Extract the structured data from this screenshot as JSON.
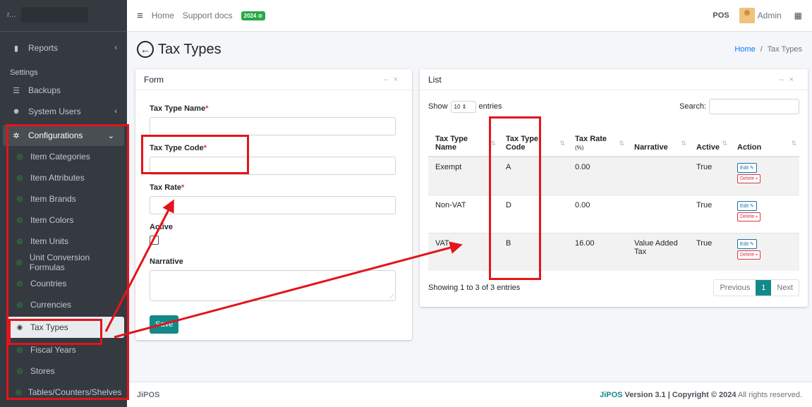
{
  "brand": {
    "text": "r..."
  },
  "sidebar": {
    "reports": "Reports",
    "settings_header": "Settings",
    "backups": "Backups",
    "system_users": "System Users",
    "configurations": "Configurations",
    "items": [
      "Item Categories",
      "Item Attributes",
      "Item Brands",
      "Item Colors",
      "Item Units",
      "Unit Conversion Formulas",
      "Countries",
      "Currencies",
      "Tax Types",
      "Fiscal Years",
      "Stores",
      "Tables/Counters/Shelves"
    ],
    "active_item": "Tax Types"
  },
  "topbar": {
    "home": "Home",
    "support": "Support docs",
    "year_badge": "2024 ⊘",
    "pos": "POS",
    "admin": "Admin"
  },
  "header": {
    "title": "Tax Types",
    "breadcrumb_home": "Home",
    "breadcrumb_sep": "/",
    "breadcrumb_current": "Tax Types"
  },
  "form": {
    "title": "Form",
    "tax_type_name": "Tax Type Name",
    "tax_type_code": "Tax Type Code",
    "tax_rate": "Tax Rate",
    "active": "Active",
    "narrative": "Narrative",
    "required_mark": "*",
    "save": "Save"
  },
  "list": {
    "title": "List",
    "show": "Show",
    "entries_value": "10",
    "entries": "entries",
    "search": "Search:",
    "columns": {
      "name_1": "Tax Type",
      "name_2": "Name",
      "code_1": "Tax Type",
      "code_2": "Code",
      "rate": "Tax Rate",
      "rate_unit": "(%)",
      "narrative": "Narrative",
      "active": "Active",
      "action": "Action"
    },
    "rows": [
      {
        "name": "Exempt",
        "code": "A",
        "rate": "0.00",
        "narrative": "",
        "active": "True"
      },
      {
        "name": "Non-VAT",
        "code": "D",
        "rate": "0.00",
        "narrative": "",
        "active": "True"
      },
      {
        "name": "VAT",
        "code": "B",
        "rate": "16.00",
        "narrative": "Value Added Tax",
        "active": "True"
      }
    ],
    "edit": "Edit",
    "delete": "Delete",
    "showing": "Showing 1 to 3 of 3 entries",
    "previous": "Previous",
    "page": "1",
    "next": "Next"
  },
  "footer": {
    "brand": "JiPOS",
    "version_brand": "JiPOS",
    "version": "Version 3.1 | Copyright © 2024",
    "rights": "All rights reserved."
  },
  "colors": {
    "accent": "#138a8a",
    "annotation": "#e3141c",
    "sidebar_bg": "#343a40"
  }
}
